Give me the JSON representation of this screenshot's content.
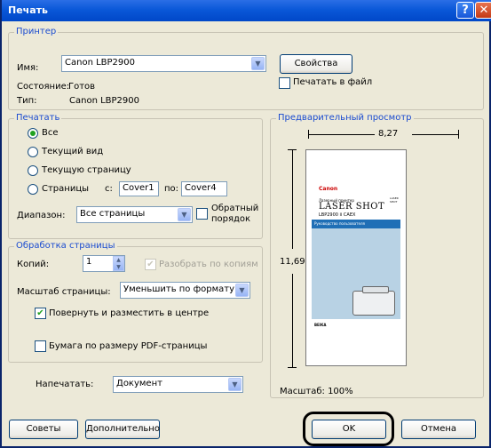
{
  "title": "Печать",
  "printer": {
    "legend": "Принтер",
    "name_label": "Имя:",
    "name_value": "Canon LBP2900",
    "properties_button": "Свойства",
    "status_label": "Состояние:",
    "status_value": "Готов",
    "type_label": "Тип:",
    "type_value": "Canon LBP2900",
    "print_to_file_label": "Печатать в файл",
    "print_to_file_checked": false
  },
  "print_range": {
    "legend": "Печатать",
    "options": [
      "Все",
      "Текущий вид",
      "Текущую страницу",
      "Страницы"
    ],
    "selected": "Все",
    "from_label": "с:",
    "from_value": "Cover1",
    "to_label": "по:",
    "to_value": "Cover4",
    "subset_label": "Диапазон:",
    "subset_value": "Все страницы",
    "reverse_label_1": "Обратный",
    "reverse_label_2": "порядок",
    "reverse_checked": false
  },
  "page_handling": {
    "legend": "Обработка страницы",
    "copies_label": "Копий:",
    "copies_value": "1",
    "collate_label": "Разобрать по копиям",
    "collate_checked": true,
    "collate_enabled": false,
    "scaling_label": "Масштаб страницы:",
    "scaling_value": "Уменьшить по формату",
    "auto_rotate_label": "Повернуть и разместить в центре",
    "auto_rotate_checked": true,
    "pdf_page_size_label": "Бумага по размеру PDF-страницы",
    "pdf_page_size_checked": false
  },
  "print_what": {
    "label": "Напечатать:",
    "value": "Документ"
  },
  "preview": {
    "legend": "Предварительный просмотр",
    "width_value": "8,27",
    "height_value": "11,69",
    "scale_text": "Масштаб: 100%",
    "doc_brand": "Canon",
    "doc_title_small": "Лазерный принтер",
    "doc_title": "LASER SHOT",
    "doc_model": "LBP2900 ii CAEX",
    "doc_band": "Руководство пользователя",
    "doc_footer_title": "BEIKA",
    "doc_logo": "LASER SHOT"
  },
  "buttons": {
    "tips": "Советы",
    "advanced": "Дополнительно",
    "ok": "OK",
    "cancel": "Отмена"
  },
  "colors": {
    "titlebar": "#0a58d8",
    "group_legend": "#1a4bd0",
    "dialog_bg": "#ece9d8",
    "radio_check": "#21a121"
  }
}
